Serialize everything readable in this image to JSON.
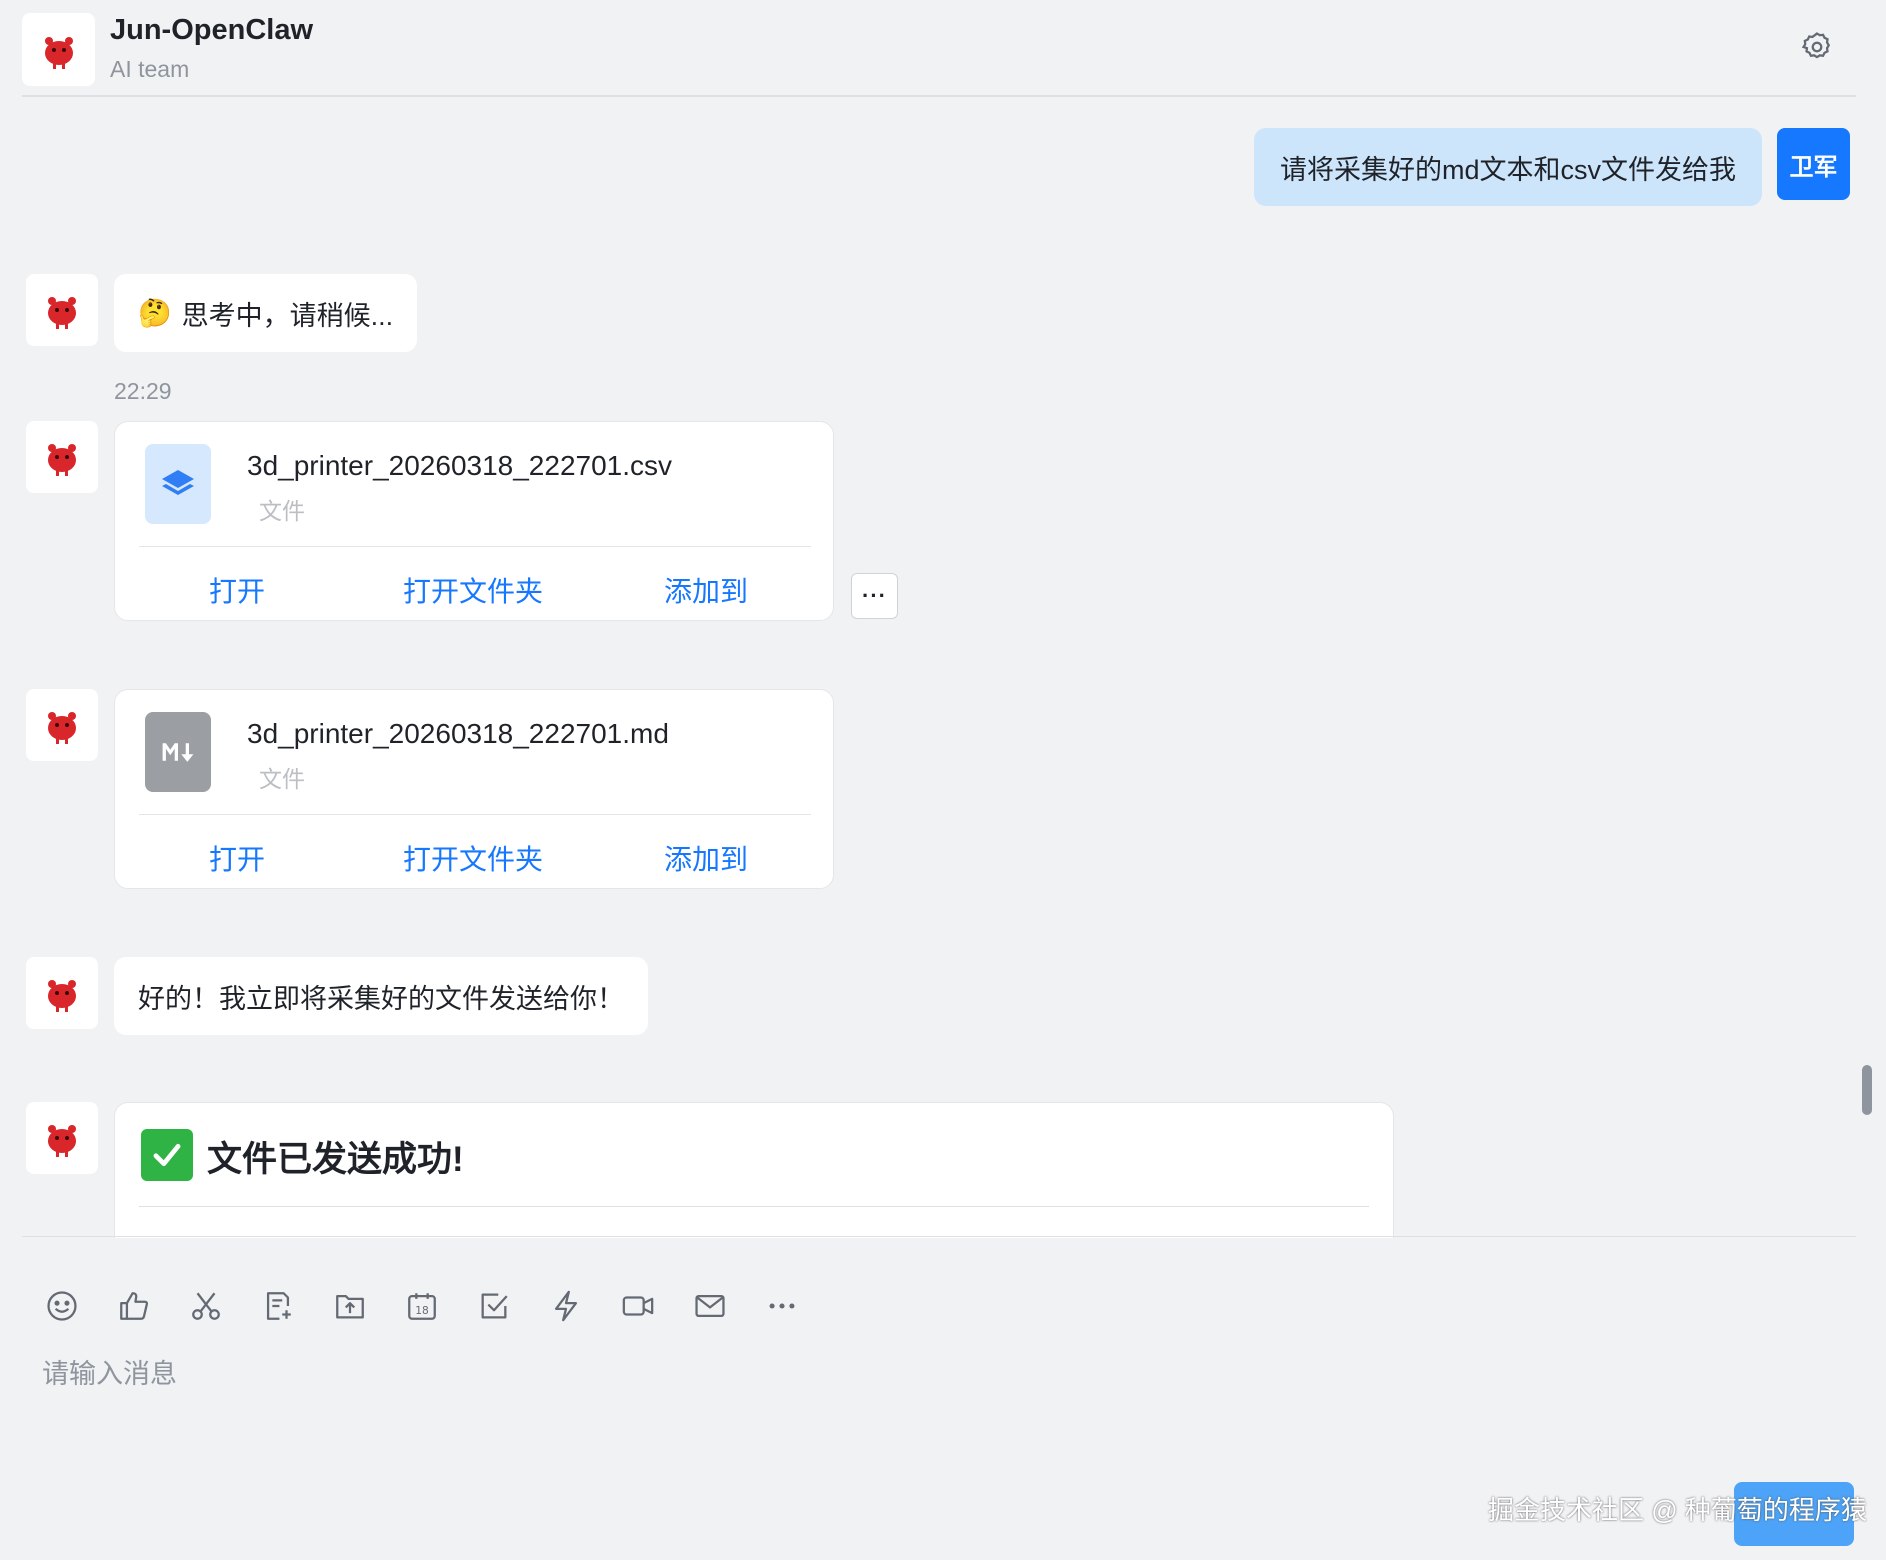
{
  "header": {
    "title": "Jun-OpenClaw",
    "subtitle": "AI team",
    "settings_icon": "gear-icon"
  },
  "messages": {
    "user_message": "请将采集好的md文本和csv文件发给我",
    "user_avatar_label": "卫军",
    "thinking_text": "思考中，请稍候...",
    "thinking_emoji": "🤔",
    "timestamp": "22:29",
    "reply_text": "好的！我立即将采集好的文件发送给你！",
    "success_title": "文件已发送成功!"
  },
  "files": [
    {
      "name": "3d_printer_20260318_222701.csv",
      "type_label": "文件",
      "icon": "csv-layers-icon",
      "actions": [
        "打开",
        "打开文件夹",
        "添加到"
      ]
    },
    {
      "name": "3d_printer_20260318_222701.md",
      "type_label": "文件",
      "icon": "markdown-icon",
      "actions": [
        "打开",
        "打开文件夹",
        "添加到"
      ]
    }
  ],
  "more_button": "···",
  "composer": {
    "placeholder": "请输入消息",
    "toolbar_icons": [
      "emoji-icon",
      "thumbs-up-icon",
      "scissors-icon",
      "doc-add-icon",
      "upload-folder-icon",
      "calendar-icon",
      "task-check-icon",
      "lightning-icon",
      "video-icon",
      "mail-icon",
      "more-icon"
    ],
    "calendar_day": "18"
  },
  "watermark": "掘金技术社区 @ 种葡萄的程序猿",
  "colors": {
    "accent": "#1677ff",
    "user_bubble": "#cce5fb",
    "background": "#f1f2f4",
    "success_green": "#2fb344"
  }
}
